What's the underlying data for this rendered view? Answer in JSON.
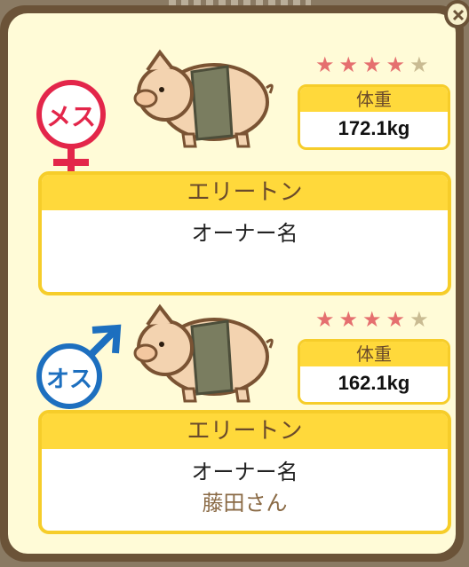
{
  "pigs": [
    {
      "gender": "female",
      "gender_label": "メス",
      "stars_total": 5,
      "stars_filled": 4,
      "weight_label": "体重",
      "weight_value": "172.1kg",
      "name": "エリートン",
      "owner_label": "オーナー名",
      "owner_name": ""
    },
    {
      "gender": "male",
      "gender_label": "オス",
      "stars_total": 5,
      "stars_filled": 4,
      "weight_label": "体重",
      "weight_value": "162.1kg",
      "name": "エリートン",
      "owner_label": "オーナー名",
      "owner_name": "藤田さん"
    }
  ],
  "colors": {
    "female": "#e3264a",
    "male": "#1d6fbf",
    "star_on": "#e56f6f",
    "star_off": "#c9bb92",
    "card_header": "#ffd93b",
    "panel_frame": "#6b5338"
  }
}
